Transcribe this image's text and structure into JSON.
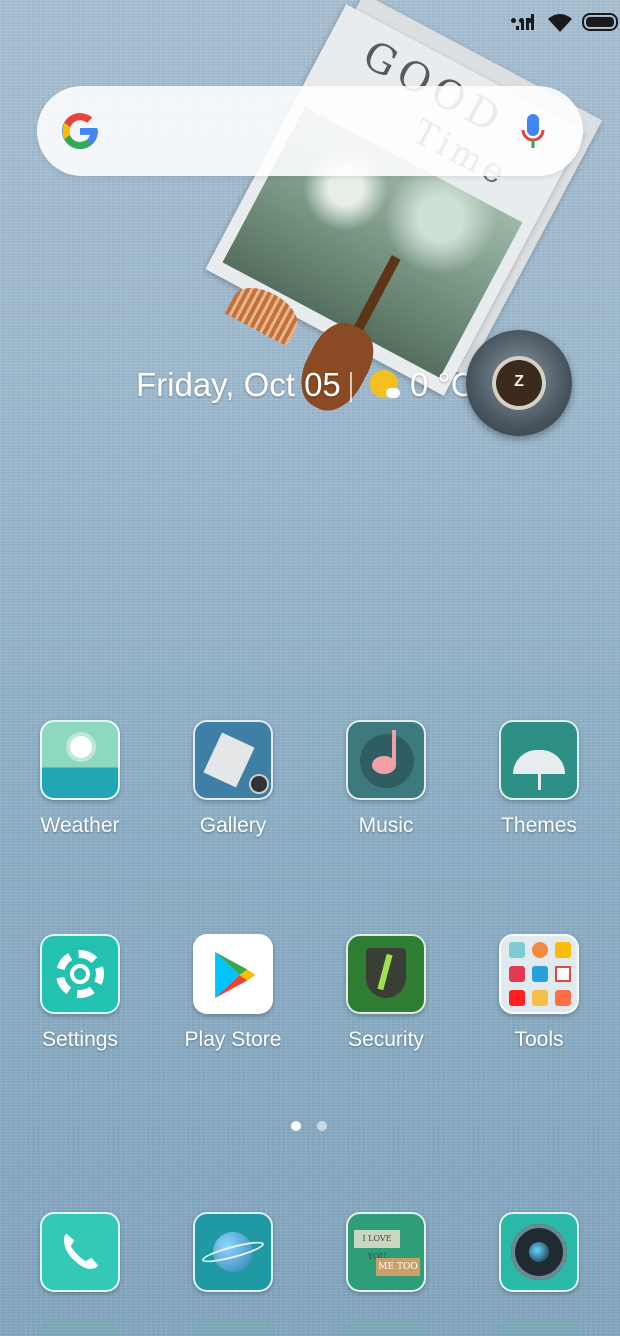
{
  "status_bar": {
    "signal_icon": "cellular-signal-icon",
    "wifi_icon": "wifi-icon",
    "battery_icon": "battery-icon",
    "battery_level": 1.0
  },
  "search": {
    "logo_icon": "google-g-icon",
    "voice_icon": "microphone-icon"
  },
  "widget": {
    "good_text": "GOOD",
    "time_text": "Time",
    "date": "Friday, Oct 05",
    "weather_icon": "partly-sunny-icon",
    "temperature": "0 °C"
  },
  "floating_button": {
    "icon": "coffee-cup-icon"
  },
  "apps": {
    "row1": [
      {
        "label": "Weather",
        "icon": "weather-icon"
      },
      {
        "label": "Gallery",
        "icon": "gallery-icon"
      },
      {
        "label": "Music",
        "icon": "music-icon"
      },
      {
        "label": "Themes",
        "icon": "themes-umbrella-icon"
      }
    ],
    "row2": [
      {
        "label": "Settings",
        "icon": "settings-gear-icon"
      },
      {
        "label": "Play Store",
        "icon": "play-store-icon"
      },
      {
        "label": "Security",
        "icon": "security-shield-icon"
      },
      {
        "label": "Tools",
        "icon": "tools-folder-icon"
      }
    ]
  },
  "page_indicator": {
    "pages": 2,
    "active": 1
  },
  "dock": [
    {
      "icon": "phone-icon"
    },
    {
      "icon": "browser-globe-icon"
    },
    {
      "icon": "messaging-icon",
      "text_top": "I LOVE YOU",
      "text_bottom": "ME TOO"
    },
    {
      "icon": "camera-icon"
    }
  ]
}
